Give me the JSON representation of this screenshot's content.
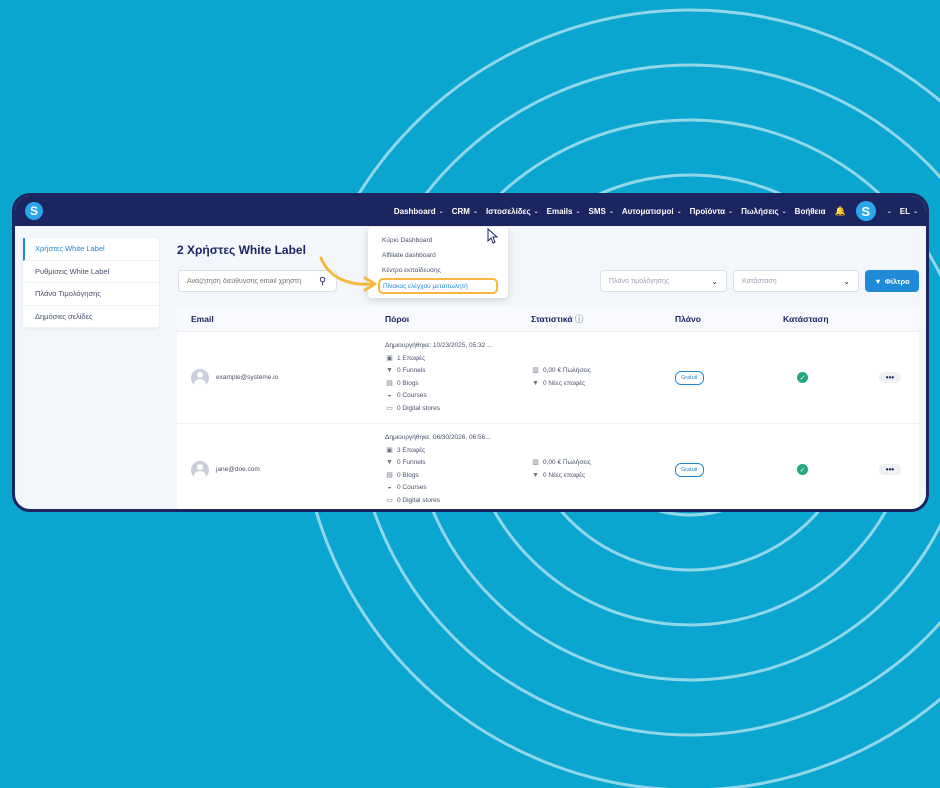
{
  "nav": {
    "items": [
      {
        "label": "Dashboard"
      },
      {
        "label": "CRM"
      },
      {
        "label": "Ιστοσελίδες"
      },
      {
        "label": "Emails"
      },
      {
        "label": "SMS"
      },
      {
        "label": "Αυτοματισμοί"
      },
      {
        "label": "Προϊόντα"
      },
      {
        "label": "Πωλήσεις"
      },
      {
        "label": "Βοήθεια"
      }
    ],
    "lang": "EL",
    "logo_letter": "S"
  },
  "dropdown": {
    "items": [
      "Κύριο Dashboard",
      "Affiliate dashboard",
      "Κέντρο εκπαίδευσης",
      "Πίνακας ελέγχου μεταπωλητή"
    ],
    "highlight_color": "#f5b840"
  },
  "sidebar": {
    "items": [
      "Χρήστες White Label",
      "Ρυθμίσεις White Label",
      "Πλάνα Τιμολόγησης",
      "Δημόσιες σελίδες"
    ]
  },
  "page": {
    "title": "2 Χρήστες White Label",
    "search_placeholder": "Αναζήτηση διεύθυνσης email χρήστη",
    "plan_select": "Πλάνο τιμολόγησης",
    "status_select": "Κατάσταση",
    "filter_button": "Φίλτρο"
  },
  "table": {
    "headers": [
      "Email",
      "Πόροι",
      "Στατιστικά",
      "Πλάνο",
      "Κατάσταση"
    ],
    "rows": [
      {
        "email": "example@systeme.io",
        "created": "Δημιουργήθηκε: 10/23/2025, 05:32 ...",
        "contacts": "1 Επαφές",
        "funnels": "0 Funnels",
        "blogs": "0 Blogs",
        "courses": "0 Courses",
        "stores": "0 Digital stores",
        "sales": "0,00 € Πωλήσεις",
        "new_contacts": "0 Νέες επαφές",
        "plan": "Gratuit",
        "action": "•••"
      },
      {
        "email": "jane@doe.com",
        "created": "Δημιουργήθηκε: 06/30/2026, 06:56...",
        "contacts": "3 Επαφές",
        "funnels": "0 Funnels",
        "blogs": "0 Blogs",
        "courses": "0 Courses",
        "stores": "0 Digital stores",
        "sales": "0,00 € Πωλήσεις",
        "new_contacts": "0 Νέες επαφές",
        "plan": "Gratuit",
        "action": "•••"
      }
    ]
  },
  "colors": {
    "background": "#0aa6cf",
    "topbar": "#1b2660",
    "accent": "#1f8ad7",
    "success": "#22a67a"
  }
}
